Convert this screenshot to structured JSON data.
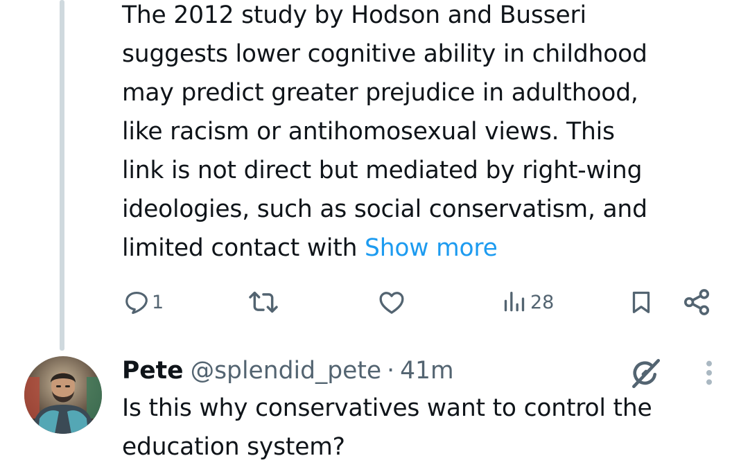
{
  "parent_tweet": {
    "text_lines": [
      "The 2012 study by Hodson and Busseri",
      "suggests lower cognitive ability in childhood",
      "may predict greater prejudice in adulthood,",
      "like racism or antihomosexual views. This",
      "link is not direct but mediated by right-wing",
      "ideologies, such as social conservatism, and",
      "limited contact with "
    ],
    "show_more_label": "Show more",
    "actions": {
      "reply_count": "1",
      "retweet_count": "",
      "like_count": "",
      "views_count": "28"
    }
  },
  "reply": {
    "name": "Pete",
    "handle": "@splendid_pete",
    "separator": "·",
    "time": "41m",
    "text_lines": [
      "Is this why conservatives want to control the",
      "education system?"
    ]
  },
  "colors": {
    "link": "#1d9bf0",
    "secondary_text": "#536471",
    "thread_line": "#cfd9de",
    "primary_text": "#0f1419"
  },
  "icons": {
    "reply": "reply-icon",
    "retweet": "retweet-icon",
    "like": "heart-icon",
    "views": "views-icon",
    "bookmark": "bookmark-icon",
    "share": "share-icon",
    "grok": "grok-icon",
    "more": "more-options-icon"
  }
}
